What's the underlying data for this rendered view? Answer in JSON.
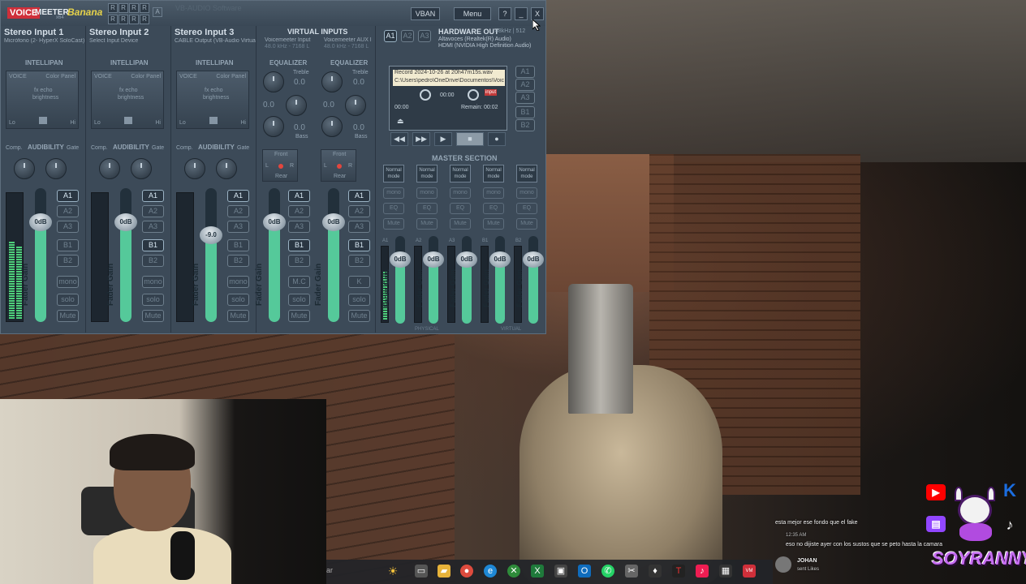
{
  "app": {
    "logo_voice": "VOICE",
    "logo_meeter": "MEETER",
    "logo_banana": "Banana",
    "logo_x64": "x64",
    "r_grid": [
      "R",
      "R",
      "R",
      "R",
      "R",
      "R",
      "R",
      "R"
    ],
    "r_box": "A",
    "watermark": "VB-AUDIO Software",
    "vban": "VBAN",
    "menu": "Menu",
    "help": "?",
    "minimize": "_",
    "close": "X"
  },
  "strips": [
    {
      "title": "Stereo Input 1",
      "device": "Micrófono (2- HyperX SoloCast)",
      "fader": "0dB",
      "gain_label": "Fader Gain"
    },
    {
      "title": "Stereo Input 2",
      "device": "Select Input Device",
      "fader": "0dB",
      "gain_label": "Fader Gain"
    },
    {
      "title": "Stereo Input 3",
      "device": "CABLE Output (VB-Audio Virtual",
      "fader": "-9.0",
      "gain_label": "Fader Gain"
    }
  ],
  "strip_labels": {
    "intellipan": "INTELLIPAN",
    "voice": "VOICE",
    "color_panel": "Color Panel",
    "fx_echo": "fx echo",
    "brightness": "brightness",
    "lo": "Lo",
    "hi": "Hi",
    "comp": "Comp.",
    "audibility": "AUDIBILITY",
    "gate": "Gate"
  },
  "bus_buttons": [
    "A1",
    "A2",
    "A3",
    "B1",
    "B2"
  ],
  "strip_extra": [
    "mono",
    "solo",
    "Mute"
  ],
  "virtual": {
    "title": "VIRTUAL INPUTS",
    "in1": "Voicemeeter Input",
    "in1_fmt": "48.0 kHz - 7168 L",
    "in2": "Voicemeeter AUX I",
    "in2_fmt": "48.0 kHz - 7168 L",
    "equalizer": "EQUALIZER",
    "treble": "Treble",
    "bass": "Bass",
    "eq_val": "0.0",
    "front": "Front",
    "rear": "Rear",
    "l": "L",
    "r": "R",
    "strips": [
      {
        "fader": "0dB",
        "extra": "M.C"
      },
      {
        "fader": "0dB",
        "extra": "K"
      }
    ]
  },
  "hardware": {
    "tabs": [
      "A1",
      "A2",
      "A3"
    ],
    "title": "HARDWARE OUT",
    "rate": "48kHz | 512",
    "dev1": "Altavoces (Realtek(R) Audio)",
    "dev2": "HDMI (NVIDIA High Definition Audio)"
  },
  "recorder": {
    "file": "Record 2024-10-26 at 20h47m15s.wav",
    "path": "C:\\Users\\pedro\\OneDrive\\Documentos\\Voic",
    "time": "00:00",
    "time_left": "00:00",
    "remain": "Remain: 00:02",
    "input": "input",
    "bus": [
      "A1",
      "A2",
      "A3",
      "B1",
      "B2"
    ],
    "transport": [
      "◀◀",
      "▶▶",
      "▶",
      "■",
      "●"
    ]
  },
  "master": {
    "title": "MASTER SECTION",
    "mode": "Normal mode",
    "buttons": [
      "mono",
      "EQ",
      "Mute"
    ],
    "buses": [
      {
        "label": "A1",
        "db": "0dB"
      },
      {
        "label": "A2",
        "db": "0dB"
      },
      {
        "label": "A3",
        "db": "0dB"
      },
      {
        "label": "B1",
        "db": "0dB"
      },
      {
        "label": "B2",
        "db": "0dB"
      }
    ],
    "physical": "PHYSICAL",
    "virtual": "VIRTUAL",
    "gain_label": "Fader Gain"
  },
  "chat": {
    "line1": "esta mejor ese fondo que el fake",
    "meta": "12:35 AM",
    "line2": "eso no dijiste ayer con los sustos que se peto hasta la camara",
    "user": "JOHAN",
    "user_action": "sent Likes"
  },
  "brand": "SOYRANNY",
  "taskbar": {
    "search": "ar"
  },
  "colors": {
    "accent_green": "#55c99a",
    "window_bg": "#3c4a58",
    "logo_red": "#cf2f3a",
    "banana_yellow": "#e6d34a",
    "brand_purple": "#c56cf0"
  }
}
